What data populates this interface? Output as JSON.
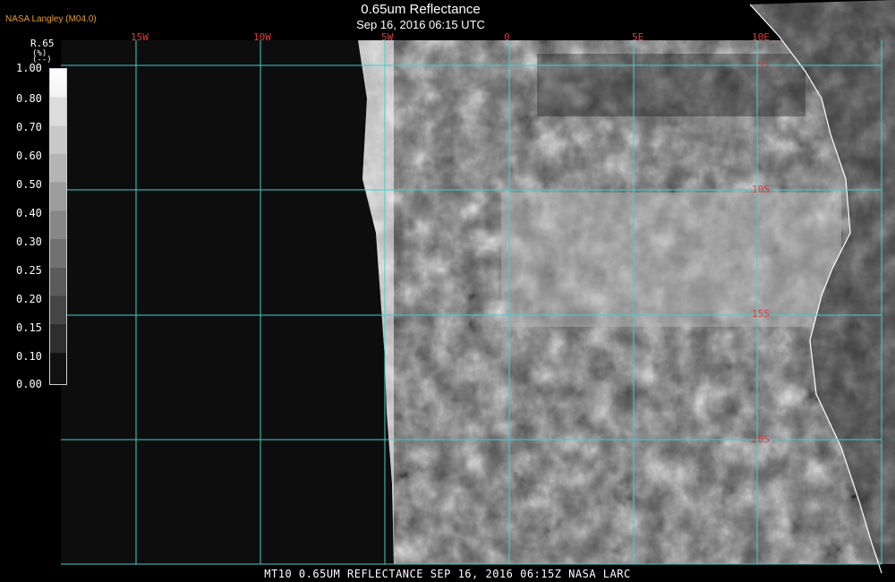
{
  "header": {
    "credit": "NASA Langley (M04.0)",
    "title": "0.65um Reflectance",
    "subtitle": "Sep 16, 2016 06:15 UTC"
  },
  "colorbar": {
    "label_line1": "R.65",
    "label_line2": "(%)",
    "label_line3": "(--)",
    "ticks": [
      "1.00",
      "0.80",
      "0.70",
      "0.60",
      "0.50",
      "0.40",
      "0.30",
      "0.25",
      "0.20",
      "0.15",
      "0.10",
      "0.00"
    ]
  },
  "map": {
    "longitude_labels": [
      "15W",
      "10W",
      "5W",
      "0",
      "5E",
      "10E"
    ],
    "latitude_labels": [
      "5S",
      "10S",
      "15S",
      "20S"
    ],
    "grid_color": "#3fd0d0",
    "label_color": "#e03a3a",
    "coastline_color": "#ffffff"
  },
  "footer": {
    "caption": "MT10  0.65UM REFLECTANCE   SEP 16, 2016 06:15Z   NASA LARC"
  }
}
